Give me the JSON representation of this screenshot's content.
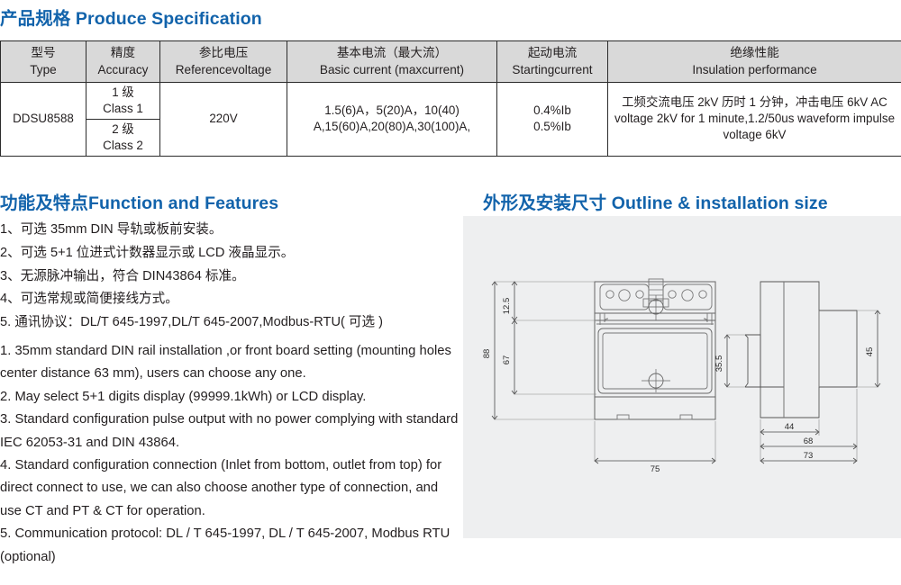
{
  "sections": {
    "spec_title": "产品规格 Produce Specification",
    "function_title": "功能及特点Function and Features",
    "outline_title": "外形及安装尺寸 Outline & installation size"
  },
  "colors": {
    "heading_blue": "#1263ab",
    "table_header_bg": "#d9d9d9",
    "panel_bg": "#eeeff0",
    "border": "#2b2b2b",
    "text": "#231f20"
  },
  "spec_table": {
    "headers": [
      {
        "cn": "型号",
        "en": "Type"
      },
      {
        "cn": "精度",
        "en": "Accuracy"
      },
      {
        "cn": "参比电压",
        "en": "Referencevoltage"
      },
      {
        "cn": "基本电流（最大流）",
        "en": "Basic current (maxcurrent)"
      },
      {
        "cn": "起动电流",
        "en": "Startingcurrent"
      },
      {
        "cn": "绝缘性能",
        "en": "Insulation performance"
      }
    ],
    "type": "DDSU8588",
    "accuracy": [
      {
        "cn": "1 级",
        "en": "Class 1"
      },
      {
        "cn": "2 级",
        "en": "Class 2"
      }
    ],
    "reference_voltage": "220V",
    "basic_current_line1": "1.5(6)A，5(20)A，10(40)",
    "basic_current_line2": "A,15(60)A,20(80)A,30(100)A,",
    "starting_current_line1": "0.4%Ib",
    "starting_current_line2": "0.5%Ib",
    "insulation": "工频交流电压 2kV 历时 1 分钟，冲击电压 6kV  AC voltage 2kV for 1 minute,1.2/50us waveform impulse voltage 6kV"
  },
  "features_cn": [
    "1、可选 35mm DIN 导轨或板前安装。",
    "2、可选 5+1 位进式计数器显示或 LCD 液晶显示。",
    "3、无源脉冲输出，符合 DIN43864 标准。",
    "4、可选常规或简便接线方式。",
    "5. 通讯协议：DL/T 645-1997,DL/T 645-2007,Modbus-RTU( 可选 )"
  ],
  "features_en": [
    "1. 35mm standard DIN rail installation ,or front board setting (mounting holes center distance 63 mm), users can choose any one.",
    "2. May select 5+1 digits display (99999.1kWh) or LCD display.",
    "3. Standard configuration pulse output with no power complying with standard IEC 62053-31 and DIN 43864.",
    "4. Standard configuration connection (Inlet from bottom, outlet from top) for direct connect to use, we can also choose another type of connection, and use CT and PT & CT for operation.",
    "5. Communication protocol: DL / T 645-1997, DL / T 645-2007, Modbus RTU (optional)"
  ],
  "drawing": {
    "front_view": {
      "dim_height_total": "88",
      "dim_height_inner": "67",
      "dim_top_offset": "12.5",
      "dim_width": "75"
    },
    "side_view": {
      "dim_rail_height": "35.5",
      "dim_front_height": "45",
      "dim_depth_inner": "44",
      "dim_depth_mid": "68",
      "dim_depth_total": "73"
    }
  }
}
